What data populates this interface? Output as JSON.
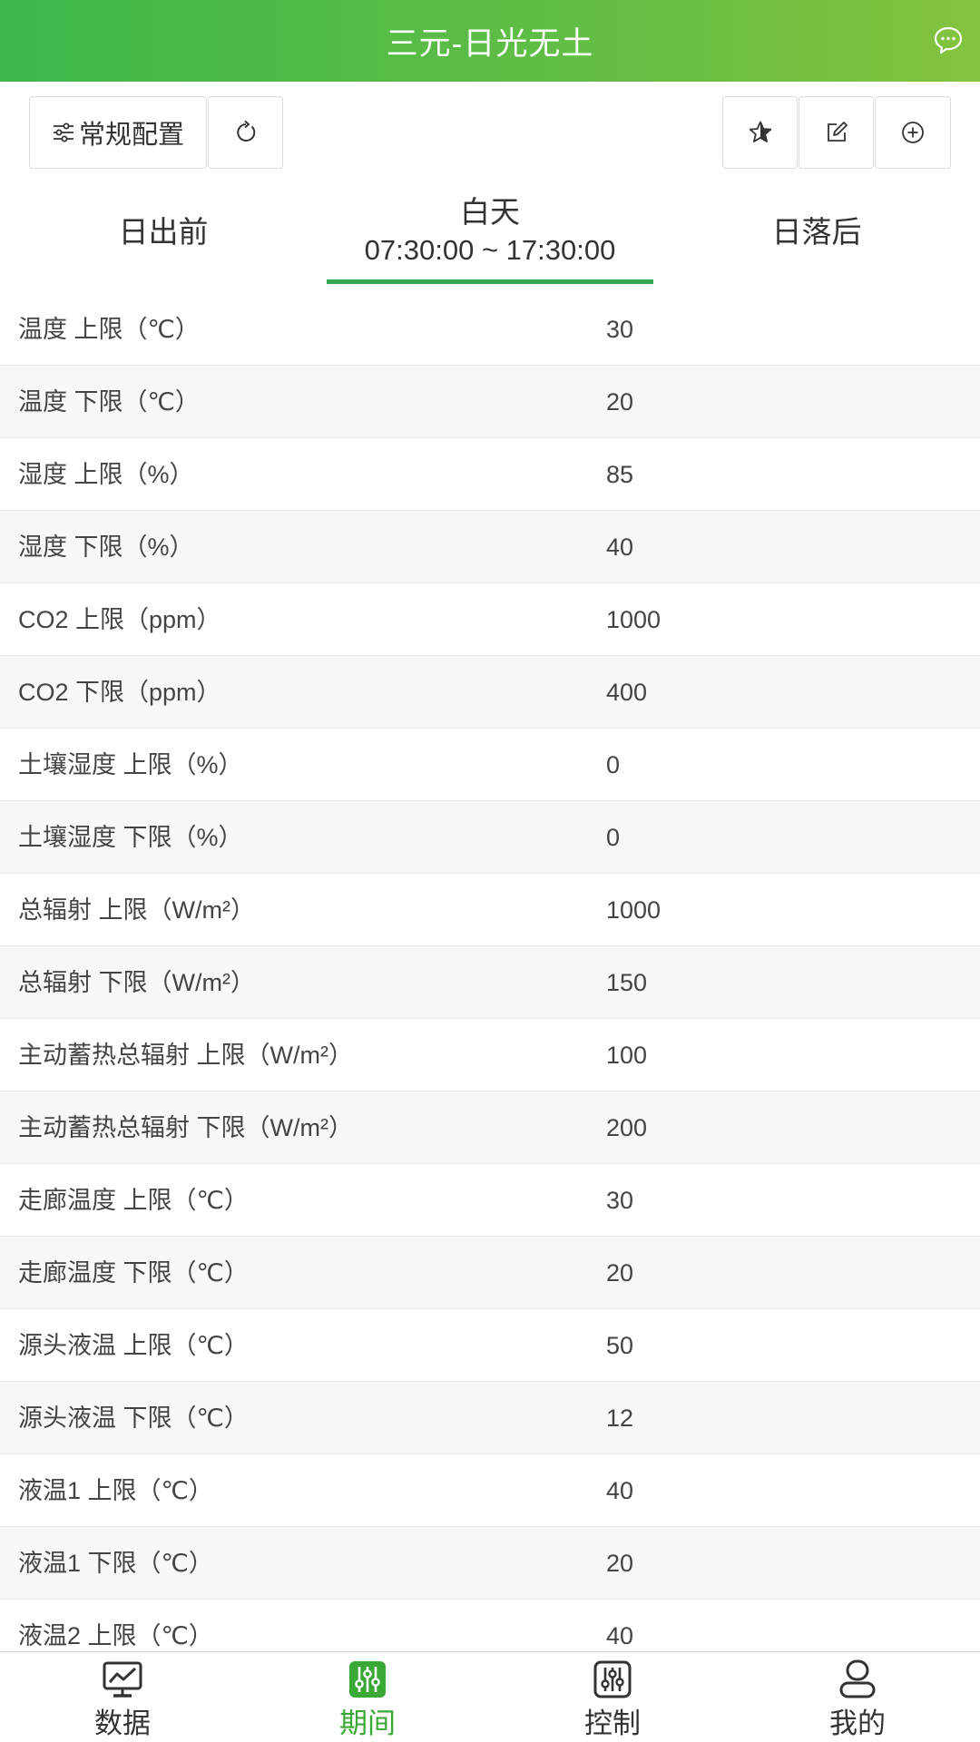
{
  "header": {
    "title": "三元-日光无土"
  },
  "toolbar": {
    "config_label": "常规配置"
  },
  "periods": {
    "before": "日出前",
    "day": {
      "label": "白天",
      "time": "07:30:00 ~ 17:30:00"
    },
    "after": "日落后",
    "active": "day"
  },
  "table": {
    "rows": [
      {
        "label": "温度 上限（℃）",
        "value": "30"
      },
      {
        "label": "温度 下限（℃）",
        "value": "20"
      },
      {
        "label": "湿度 上限（%）",
        "value": "85"
      },
      {
        "label": "湿度 下限（%）",
        "value": "40"
      },
      {
        "label": "CO2 上限（ppm）",
        "value": "1000"
      },
      {
        "label": "CO2 下限（ppm）",
        "value": "400"
      },
      {
        "label": "土壤湿度 上限（%）",
        "value": "0"
      },
      {
        "label": "土壤湿度 下限（%）",
        "value": "0"
      },
      {
        "label": "总辐射 上限（W/m²）",
        "value": "1000"
      },
      {
        "label": "总辐射 下限（W/m²）",
        "value": "150"
      },
      {
        "label": "主动蓄热总辐射 上限（W/m²）",
        "value": "100"
      },
      {
        "label": "主动蓄热总辐射 下限（W/m²）",
        "value": "200"
      },
      {
        "label": "走廊温度 上限（℃）",
        "value": "30"
      },
      {
        "label": "走廊温度 下限（℃）",
        "value": "20"
      },
      {
        "label": "源头液温 上限（℃）",
        "value": "50"
      },
      {
        "label": "源头液温 下限（℃）",
        "value": "12"
      },
      {
        "label": "液温1 上限（℃）",
        "value": "40"
      },
      {
        "label": "液温1 下限（℃）",
        "value": "20"
      },
      {
        "label": "液温2 上限（℃）",
        "value": "40"
      }
    ]
  },
  "tabbar": {
    "items": [
      {
        "label": "数据",
        "icon": "monitor-chart-icon"
      },
      {
        "label": "期间",
        "icon": "sliders-icon",
        "active": true
      },
      {
        "label": "控制",
        "icon": "control-sliders-icon"
      },
      {
        "label": "我的",
        "icon": "user-icon"
      }
    ]
  },
  "colors": {
    "accent": "#3aa835",
    "header_start": "#3db84a",
    "header_end": "#84c33f"
  }
}
